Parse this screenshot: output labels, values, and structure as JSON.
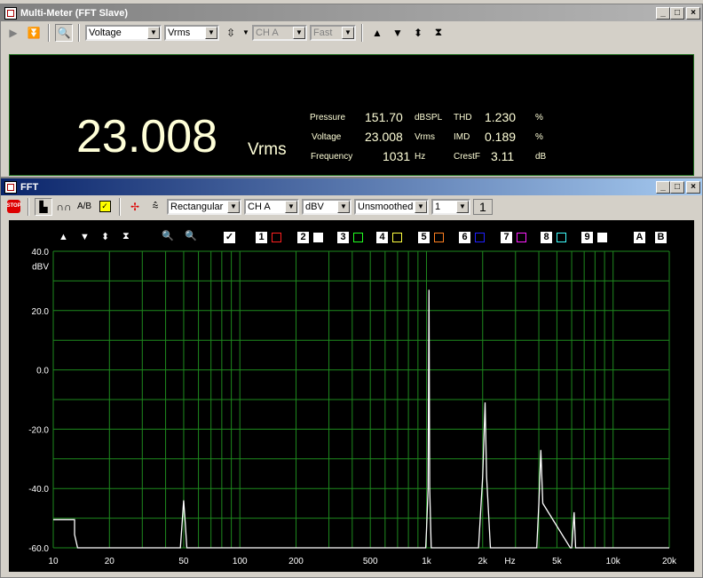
{
  "mm": {
    "title": "Multi-Meter (FFT Slave)",
    "func": "Voltage",
    "unit": "Vrms",
    "ch": "CH A",
    "speed": "Fast",
    "value": "23.008",
    "value_unit": "Vrms",
    "readouts": [
      {
        "label": "Pressure",
        "value": "151.70",
        "unit": "dBSPL"
      },
      {
        "label": "Voltage",
        "value": "23.008",
        "unit": "Vrms"
      },
      {
        "label": "Frequency",
        "value": "1031",
        "unit": "Hz"
      }
    ],
    "dist": [
      {
        "label": "THD",
        "value": "1.230",
        "unit": "%"
      },
      {
        "label": "IMD",
        "value": "0.189",
        "unit": "%"
      },
      {
        "label": "CrestF",
        "value": "3.11",
        "unit": "dB"
      }
    ]
  },
  "fft": {
    "title": "FFT",
    "window": "Rectangular",
    "ch": "CH A",
    "unit": "dBV",
    "smooth": "Unsmoothed",
    "avg": "1",
    "avg_count": "1",
    "traces": [
      "1",
      "2",
      "3",
      "4",
      "5",
      "6",
      "7",
      "8",
      "9"
    ],
    "trace_colors": [
      "#ff2020",
      "#ffffff",
      "#20ff20",
      "#ffff40",
      "#ff8020",
      "#2020ff",
      "#ff20ff",
      "#40ffff",
      "#ffffff"
    ],
    "cursors": [
      "A",
      "B"
    ]
  },
  "chart_data": {
    "type": "line",
    "ylabel": "dBV",
    "xlabel": "Hz",
    "xscale": "log",
    "xlim": [
      10,
      20000
    ],
    "ylim": [
      -60,
      40
    ],
    "grid": true,
    "ytick_labels": [
      "40.0",
      "20.0",
      "0.0",
      "-20.0",
      "-40.0",
      "-60.0"
    ],
    "ytick_values": [
      40,
      20,
      0,
      -20,
      -40,
      -60
    ],
    "xtick_labels": [
      "10",
      "20",
      "50",
      "100",
      "200",
      "500",
      "1k",
      "2k",
      "5k",
      "10k",
      "20k"
    ],
    "xtick_values": [
      10,
      20,
      50,
      100,
      200,
      500,
      1000,
      2000,
      5000,
      10000,
      20000
    ],
    "series": [
      {
        "color": "#ffffff",
        "x": [
          10,
          13,
          13,
          13.5,
          14,
          30,
          31,
          48,
          49,
          50,
          51,
          52,
          990,
          1000,
          1020,
          1031,
          1040,
          1060,
          1900,
          2000,
          2060,
          2100,
          2200,
          3900,
          4000,
          4100,
          4200,
          5900,
          6000,
          6180,
          6300,
          20000
        ],
        "y": [
          -50.5,
          -50.5,
          -55.5,
          -60,
          -60,
          -60,
          -60,
          -60,
          -52,
          -44,
          -52,
          -60,
          -60,
          -54,
          -40,
          27,
          -40,
          -60,
          -60,
          -36,
          -11,
          -36,
          -60,
          -60,
          -45,
          -27,
          -45,
          -60,
          -60,
          -48,
          -60,
          -60
        ]
      }
    ]
  }
}
